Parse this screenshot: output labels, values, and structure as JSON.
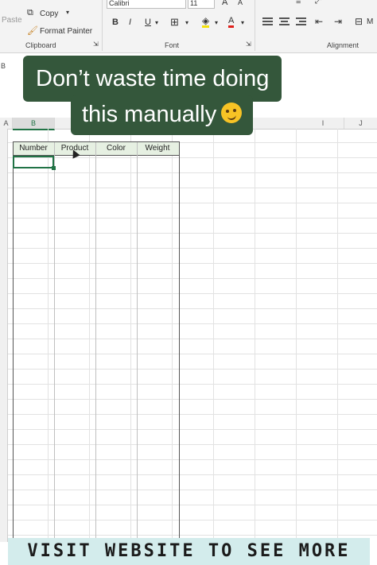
{
  "ribbon": {
    "paste_label": "Paste",
    "copy_label": "Copy",
    "format_painter_label": "Format Painter",
    "clipboard_group": "Clipboard",
    "font_name": "Calibri",
    "font_size": "11",
    "bold": "B",
    "italic": "I",
    "underline": "U",
    "grow_font": "A",
    "shrink_font": "A",
    "font_color": "A",
    "font_group": "Font",
    "alignment_group": "Alignment",
    "merge_label": "M"
  },
  "name_box": "B",
  "columns": [
    {
      "label": "A"
    },
    {
      "label": "B"
    },
    {
      "label": "I"
    },
    {
      "label": "J"
    }
  ],
  "table": {
    "headers": [
      "Number",
      "Product",
      "Color",
      "Weight"
    ]
  },
  "caption": {
    "line1": "Don’t waste time doing",
    "line2": "this manually"
  },
  "banner": {
    "text": "VISIT WEBSITE TO SEE MORE"
  },
  "colors": {
    "caption_bg": "#34573b",
    "banner_bg": "#d3ecec",
    "excel_green": "#217346",
    "header_fill": "#e6f0e2"
  }
}
